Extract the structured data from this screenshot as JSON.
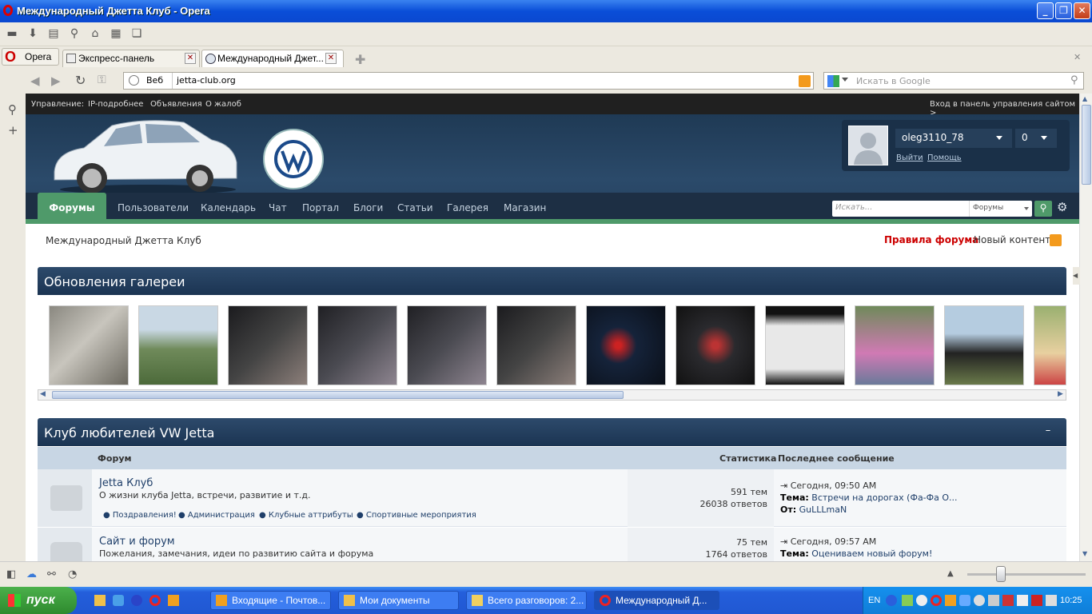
{
  "window": {
    "title": "Международный Джетта Клуб - Opera"
  },
  "toolbar": {
    "icons": [
      "folder-icon",
      "download-icon",
      "print-icon",
      "search-icon",
      "home-icon",
      "panels-icon",
      "windows-icon"
    ]
  },
  "tabs": {
    "opera_button": "Opera",
    "items": [
      {
        "label": "Экспресс-панель"
      },
      {
        "label": "Международный Джет..."
      }
    ]
  },
  "address": {
    "web_label": "Веб",
    "url": "jetta-club.org",
    "search_placeholder": "Искать в Google"
  },
  "site": {
    "topstrip": {
      "left_label": "Управление:",
      "links": [
        "IP-подробнее",
        "Объявления",
        "О жалоб"
      ],
      "right_link": "Вход в панель управления сайтом >"
    },
    "user": {
      "name": "oleg3110_78",
      "count": "0",
      "logout": "Выйти",
      "help": "Помощь"
    },
    "nav": {
      "items": [
        "Форумы",
        "Пользователи",
        "Календарь",
        "Чат",
        "Портал",
        "Блоги",
        "Статьи",
        "Галерея",
        "Магазин"
      ],
      "search_placeholder": "Искать...",
      "search_scope": "Форумы"
    },
    "breadcrumb": "Международный Джетта Клуб",
    "rules_link": "Правила форума",
    "new_content": "Новый контент",
    "gallery": {
      "title": "Обновления галереи"
    },
    "club": {
      "title": "Клуб любителей VW Jetta",
      "collapse": "–",
      "headers": {
        "forum": "Форум",
        "stats": "Статистика",
        "last": "Последнее сообщение"
      },
      "rows": [
        {
          "name": "Jetta Клуб",
          "desc": "О жизни клуба Jetta, встречи, развитие и т.д.",
          "subforums": [
            "Поздравления!",
            "Администрация",
            "Клубные аттрибуты",
            "Спортивные мероприятия"
          ],
          "topics": "591 тем",
          "posts": "26038 ответов",
          "last_date": "Сегодня, 09:50 AM",
          "topic_label": "Тема:",
          "topic": "Встречи на дорогах (Фа-Фа О...",
          "from_label": "От:",
          "from": "GuLLLmaN"
        },
        {
          "name": "Сайт и форум",
          "desc": "Пожелания, замечания, идеи по развитию сайта и форума",
          "topics": "75 тем",
          "posts": "1764 ответов",
          "last_date": "Сегодня, 09:57 AM",
          "topic_label": "Тема:",
          "topic": "Оцениваем новый форум!"
        }
      ]
    }
  },
  "taskbar": {
    "start": "пуск",
    "tasks": [
      "Входящие - Почтов...",
      "Мои документы",
      "Всего разговоров: 2...",
      "Международный Д..."
    ],
    "lang": "EN",
    "clock": "10:25"
  }
}
